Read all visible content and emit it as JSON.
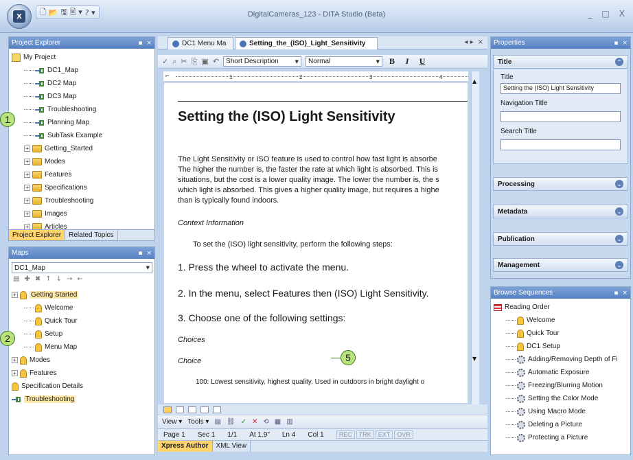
{
  "window": {
    "title": "DigitalCameras_123 - DITA Studio (Beta)",
    "orb_label": "X",
    "minimize": "_",
    "maximize": "□",
    "close": "X"
  },
  "qat": [
    "🗋",
    "📂",
    "🖫",
    "🖹 ▾",
    "? ▾"
  ],
  "project_explorer": {
    "header": "Project Explorer",
    "items": [
      {
        "label": "My Project",
        "icon": "project-icon",
        "level": 0
      },
      {
        "label": "DC1_Map",
        "icon": "map-icon",
        "level": 1
      },
      {
        "label": "DC2 Map",
        "icon": "map-icon",
        "level": 1
      },
      {
        "label": "DC3 Map",
        "icon": "map-icon",
        "level": 1
      },
      {
        "label": "Troubleshooting",
        "icon": "map-icon",
        "level": 1
      },
      {
        "label": "Planning Map",
        "icon": "map-icon",
        "level": 1
      },
      {
        "label": "SubTask Example",
        "icon": "map-icon",
        "level": 1
      },
      {
        "label": "Getting_Started",
        "icon": "folder-icon",
        "level": 1,
        "expandable": true
      },
      {
        "label": "Modes",
        "icon": "folder-icon",
        "level": 1,
        "expandable": true
      },
      {
        "label": "Features",
        "icon": "folder-icon",
        "level": 1,
        "expandable": true
      },
      {
        "label": "Specifications",
        "icon": "folder-icon",
        "level": 1,
        "expandable": true
      },
      {
        "label": "Troubleshooting",
        "icon": "folder-icon",
        "level": 1,
        "expandable": true
      },
      {
        "label": "Images",
        "icon": "folder-icon",
        "level": 1,
        "expandable": true
      },
      {
        "label": "Articles",
        "icon": "folder-icon",
        "level": 1,
        "expandable": true
      }
    ],
    "tabs": [
      "Project Explorer",
      "Related Topics"
    ]
  },
  "maps": {
    "header": "Maps",
    "selected_map": "DC1_Map",
    "items": [
      {
        "label": "Getting Started",
        "icon": "topic-icon",
        "level": 0,
        "expandable": true,
        "highlight": true
      },
      {
        "label": "Welcome",
        "icon": "topic-icon",
        "level": 1
      },
      {
        "label": "Quick Tour",
        "icon": "topic-icon",
        "level": 1
      },
      {
        "label": "Setup",
        "icon": "topic-icon",
        "level": 1
      },
      {
        "label": "Menu Map",
        "icon": "topic-icon",
        "level": 1
      },
      {
        "label": "Modes",
        "icon": "topic-icon",
        "level": 0,
        "expandable": true
      },
      {
        "label": "Features",
        "icon": "topic-icon",
        "level": 0,
        "expandable": true
      },
      {
        "label": "Specification Details",
        "icon": "topic-icon",
        "level": 0
      },
      {
        "label": "Troubleshooting",
        "icon": "map-icon",
        "level": 0,
        "highlight": true
      }
    ]
  },
  "editor": {
    "tabs": [
      "DC1 Menu Ma",
      "Setting_the_(ISO)_Light_Sensitivity"
    ],
    "tab_ctrls": [
      "◂ ▸",
      "×"
    ],
    "style_combo": "Short Description",
    "para_combo": "Normal",
    "format_buttons": [
      "B",
      "I",
      "U"
    ],
    "ruler_ticks": [
      "1",
      "2",
      "3",
      "4"
    ],
    "title": "Setting the (ISO) Light Sensitivity",
    "paragraph": [
      "The Light Sensitivity or ISO feature is used to control how fast light is absorbe",
      "The higher the number is, the faster the rate at which light is absorbed. This is",
      "situations, but the cost is a lower quality image. The lower the number is, the s",
      "which light is absorbed. This gives a higher quality image, but requires a highe",
      "than is typically found indoors."
    ],
    "context_label": "Context Information",
    "context_text": "To set the (ISO) light sensitivity, perform the following steps:",
    "steps": [
      "1.  Press the wheel to activate the menu.",
      "2.  In the menu, select Features then (ISO) Light Sensitivity.",
      "3.  Choose one of the following settings:"
    ],
    "choices_label": "Choices",
    "choice_label": "Choice",
    "choice_text": "100: Lowest sensitivity, highest quality. Used in outdoors in bright daylight o",
    "toolbar2": {
      "view": "View ▾",
      "tools": "Tools ▾"
    },
    "status": {
      "page": "Page 1",
      "sec": "Sec 1",
      "pages": "1/1",
      "at": "At 1.9\"",
      "ln": "Ln 4",
      "col": "Col 1"
    },
    "status_flags": [
      "REC",
      "TRK",
      "EXT",
      "OVR"
    ],
    "view_tabs": [
      "Xpress Author",
      "XML View"
    ]
  },
  "properties": {
    "header": "Properties",
    "title_section": "Title",
    "fields": [
      {
        "label": "Title",
        "value": "Setting the (ISO) Light Sensitivity"
      },
      {
        "label": "Navigation Title",
        "value": ""
      },
      {
        "label": "Search Title",
        "value": ""
      }
    ],
    "sections": [
      "Processing",
      "Metadata",
      "Publication",
      "Management"
    ]
  },
  "browse_sequences": {
    "header": "Browse Sequences",
    "items": [
      {
        "label": "Reading Order",
        "icon": "sequence-icon",
        "level": 0
      },
      {
        "label": "Welcome",
        "icon": "topic-icon",
        "level": 1
      },
      {
        "label": "Quick Tour",
        "icon": "topic-icon",
        "level": 1
      },
      {
        "label": "DC1 Setup",
        "icon": "topic-icon",
        "level": 1
      },
      {
        "label": "Adding/Removing Depth of Fi",
        "icon": "gear-icon",
        "level": 1
      },
      {
        "label": "Automatic Exposure",
        "icon": "gear-icon",
        "level": 1
      },
      {
        "label": "Freezing/Blurring Motion",
        "icon": "gear-icon",
        "level": 1
      },
      {
        "label": "Setting the Color Mode",
        "icon": "gear-icon",
        "level": 1
      },
      {
        "label": "Using Macro Mode",
        "icon": "gear-icon",
        "level": 1
      },
      {
        "label": "Deleting a Picture",
        "icon": "gear-icon",
        "level": 1
      },
      {
        "label": "Protecting a Picture",
        "icon": "gear-icon",
        "level": 1
      }
    ]
  },
  "callouts": [
    "1",
    "2",
    "5"
  ]
}
